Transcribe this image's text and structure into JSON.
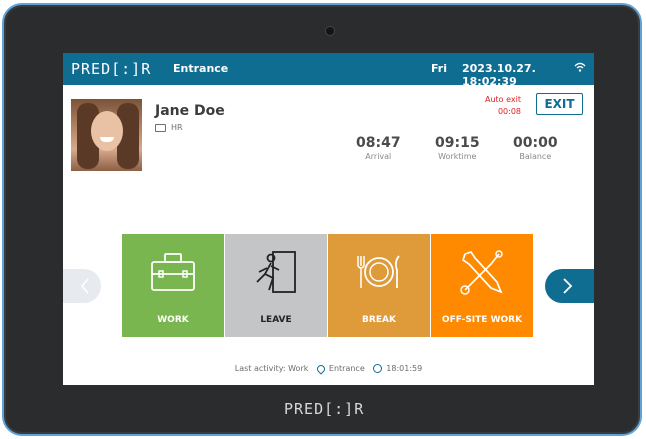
{
  "header": {
    "logo": "PRED[:]R",
    "location": "Entrance",
    "day": "Fri",
    "datetime": "2023.10.27. 18:02:39"
  },
  "user": {
    "name": "Jane Doe",
    "department": "HR"
  },
  "auto_exit": {
    "label": "Auto exit",
    "countdown": "00:08"
  },
  "exit_button": {
    "label": "EXIT"
  },
  "stats": [
    {
      "value": "08:47",
      "label": "Arrival"
    },
    {
      "value": "09:15",
      "label": "Worktime"
    },
    {
      "value": "00:00",
      "label": "Balance"
    }
  ],
  "actions": [
    {
      "label": "WORK",
      "color": "#7ab64f",
      "icon": "briefcase-icon"
    },
    {
      "label": "LEAVE",
      "color": "#c3c5c7",
      "icon": "exit-door-icon"
    },
    {
      "label": "BREAK",
      "color": "#df9a3a",
      "icon": "plate-utensils-icon"
    },
    {
      "label": "OFF-SITE WORK",
      "color": "#ff8a00",
      "icon": "tools-icon"
    }
  ],
  "status_bar": {
    "prefix": "Last activity: Work",
    "location": "Entrance",
    "time": "18:01:59"
  },
  "footer": {
    "logo": "PRED[:]R"
  },
  "colors": {
    "primary": "#0f6d92",
    "bezel": "#2b2c2e",
    "bezel_edge": "#5fa3d8",
    "alert": "#e02020"
  }
}
